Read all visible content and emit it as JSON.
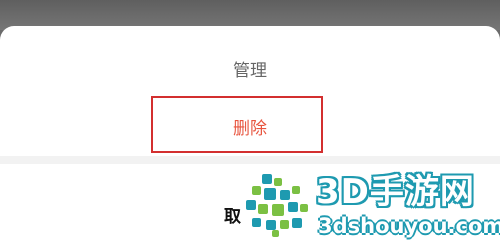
{
  "menu": {
    "items": [
      {
        "label": "管理"
      },
      {
        "label": "删除"
      }
    ],
    "cancel_label": "取"
  },
  "watermark": {
    "title": "3D手游网",
    "url": "3dshouyou.com"
  },
  "colors": {
    "delete_text": "#e8553f",
    "highlight_border": "#d32f2f",
    "watermark_outline": "#1e9ab0",
    "watermark_green": "#7bc043"
  }
}
